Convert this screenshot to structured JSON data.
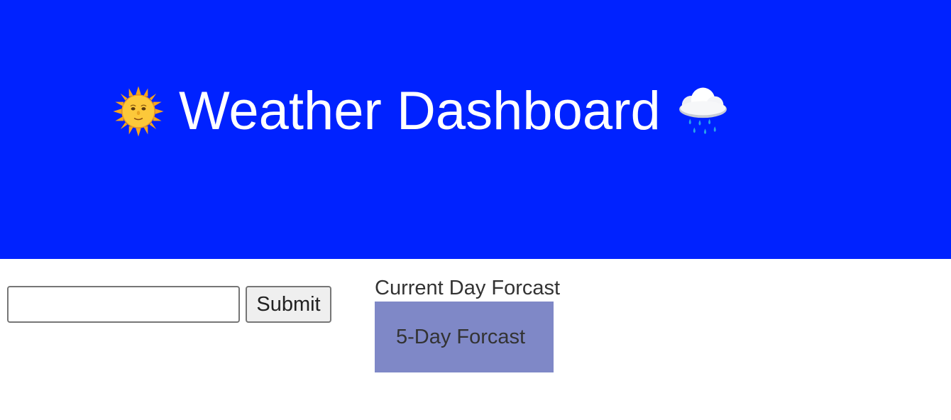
{
  "header": {
    "title": "Weather Dashboard",
    "left_icon": "sun-with-face-icon",
    "right_icon": "cloud-with-rain-icon",
    "background_color": "#0022ff"
  },
  "search": {
    "value": "",
    "placeholder": "",
    "submit_label": "Submit"
  },
  "current_day": {
    "label": "Current Day Forcast"
  },
  "five_day": {
    "label": "5-Day Forcast",
    "background_color": "#7f88c7"
  }
}
